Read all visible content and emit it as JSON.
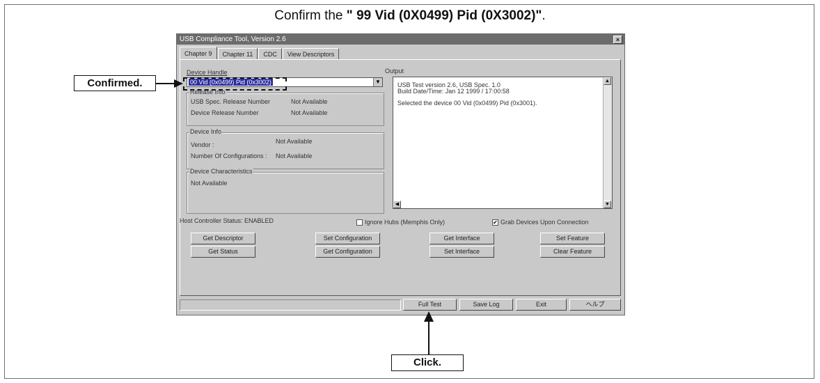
{
  "instruction": {
    "prefix": "Confirm the ",
    "emphasis": "\" 99 Vid (0X0499) Pid (0X3002)\"",
    "suffix": "."
  },
  "window": {
    "title": "USB Compliance Tool, Version 2.6",
    "close": "×",
    "tabs": [
      "Chapter 9",
      "Chapter 11",
      "CDC",
      "View Descriptors"
    ],
    "device_handle": {
      "label": "Device Handle",
      "value": "00 Vid (0x0499) Pid (0x3002)"
    },
    "release_info": {
      "title": "Release Info",
      "usb_spec_label": "USB Spec. Release Number",
      "usb_spec_value": "Not Available",
      "device_release_label": "Device Release Number",
      "device_release_value": "Not Available"
    },
    "device_info": {
      "title": "Device Info",
      "vendor_label": "Vendor :",
      "vendor_value": "Not Available",
      "configs_label": "Number Of Configurations :",
      "configs_value": "Not Available"
    },
    "device_characteristics": {
      "title": "Device Characteristics",
      "value": "Not Available"
    },
    "output": {
      "label": "Output",
      "lines": [
        "USB Test version 2.6, USB Spec. 1.0",
        "Build Date/Time: Jan 12 1999 / 17:00:58",
        "Selected the device 00 Vid (0x0499) Pid (0x3001)."
      ]
    },
    "host_status": "Host Controller Status: ENABLED",
    "ignore_hubs": "Ignore Hubs (Memphis Only)",
    "grab_devices": "Grab Devices Upon Connection",
    "grab_checked_mark": "✔",
    "buttons": {
      "get_descriptor": "Get Descriptor",
      "set_configuration": "Set Configuration",
      "get_interface": "Get Interface",
      "set_feature": "Set Feature",
      "get_status": "Get Status",
      "get_configuration": "Get Configuration",
      "set_interface": "Set Interface",
      "clear_feature": "Clear Feature",
      "full_test": "Full Test",
      "save_log": "Save Log",
      "exit": "Exit",
      "help": "ヘルプ"
    }
  },
  "callouts": {
    "confirmed": "Confirmed.",
    "click": "Click."
  }
}
